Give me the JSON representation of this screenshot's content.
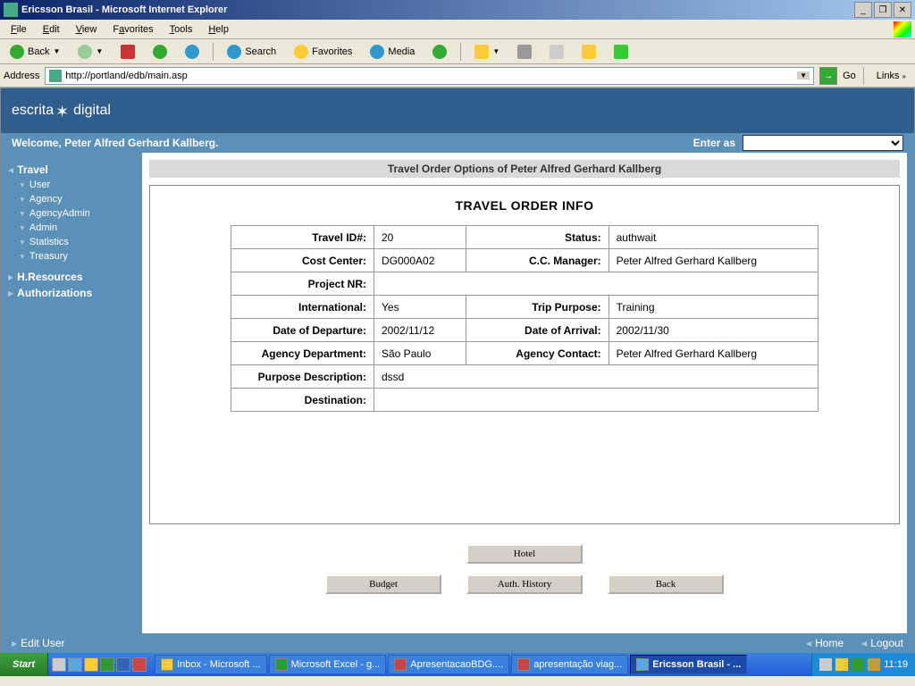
{
  "window": {
    "title": "Ericsson Brasil - Microsoft Internet Explorer"
  },
  "menubar": {
    "file": "File",
    "edit": "Edit",
    "view": "View",
    "favorites": "Favorites",
    "tools": "Tools",
    "help": "Help"
  },
  "toolbar": {
    "back": "Back",
    "search": "Search",
    "favorites": "Favorites",
    "media": "Media"
  },
  "addressbar": {
    "label": "Address",
    "url": "http://portland/edb/main.asp",
    "go": "Go",
    "links": "Links"
  },
  "app": {
    "logo_a": "escrita",
    "logo_b": "digital"
  },
  "welcome": {
    "text": "Welcome, Peter Alfred Gerhard Kallberg.",
    "enter_as": "Enter as"
  },
  "sidebar": {
    "travel": "Travel",
    "user": "User",
    "agency": "Agency",
    "agencyadmin": "AgencyAdmin",
    "admin": "Admin",
    "statistics": "Statistics",
    "treasury": "Treasury",
    "hresources": "H.Resources",
    "authorizations": "Authorizations"
  },
  "page": {
    "title": "Travel Order Options of Peter Alfred Gerhard Kallberg",
    "section": "TRAVEL ORDER INFO"
  },
  "labels": {
    "travel_id": "Travel ID#:",
    "status": "Status:",
    "cost_center": "Cost Center:",
    "cc_manager": "C.C. Manager:",
    "project_nr": "Project NR:",
    "international": "International:",
    "trip_purpose": "Trip Purpose:",
    "date_departure": "Date of Departure:",
    "date_arrival": "Date of Arrival:",
    "agency_dept": "Agency Department:",
    "agency_contact": "Agency Contact:",
    "purpose_desc": "Purpose Description:",
    "destination": "Destination:"
  },
  "values": {
    "travel_id": "20",
    "status": "authwait",
    "cost_center": "DG000A02",
    "cc_manager": "Peter Alfred Gerhard Kallberg",
    "project_nr": "",
    "international": "Yes",
    "trip_purpose": "Training",
    "date_departure": "2002/11/12",
    "date_arrival": "2002/11/30",
    "agency_dept": "São Paulo",
    "agency_contact": "Peter Alfred Gerhard Kallberg",
    "purpose_desc": "dssd",
    "destination": ""
  },
  "buttons": {
    "hotel": "Hotel",
    "budget": "Budget",
    "auth_history": "Auth. History",
    "back": "Back"
  },
  "footer": {
    "edit_user": "Edit User",
    "home": "Home",
    "logout": "Logout"
  },
  "taskbar": {
    "start": "Start",
    "items": [
      "Inbox - Microsoft ...",
      "Microsoft Excel - g...",
      "ApresentacaoBDG....",
      "apresentação viag...",
      "Ericsson Brasil - ..."
    ],
    "clock": "11:19"
  }
}
